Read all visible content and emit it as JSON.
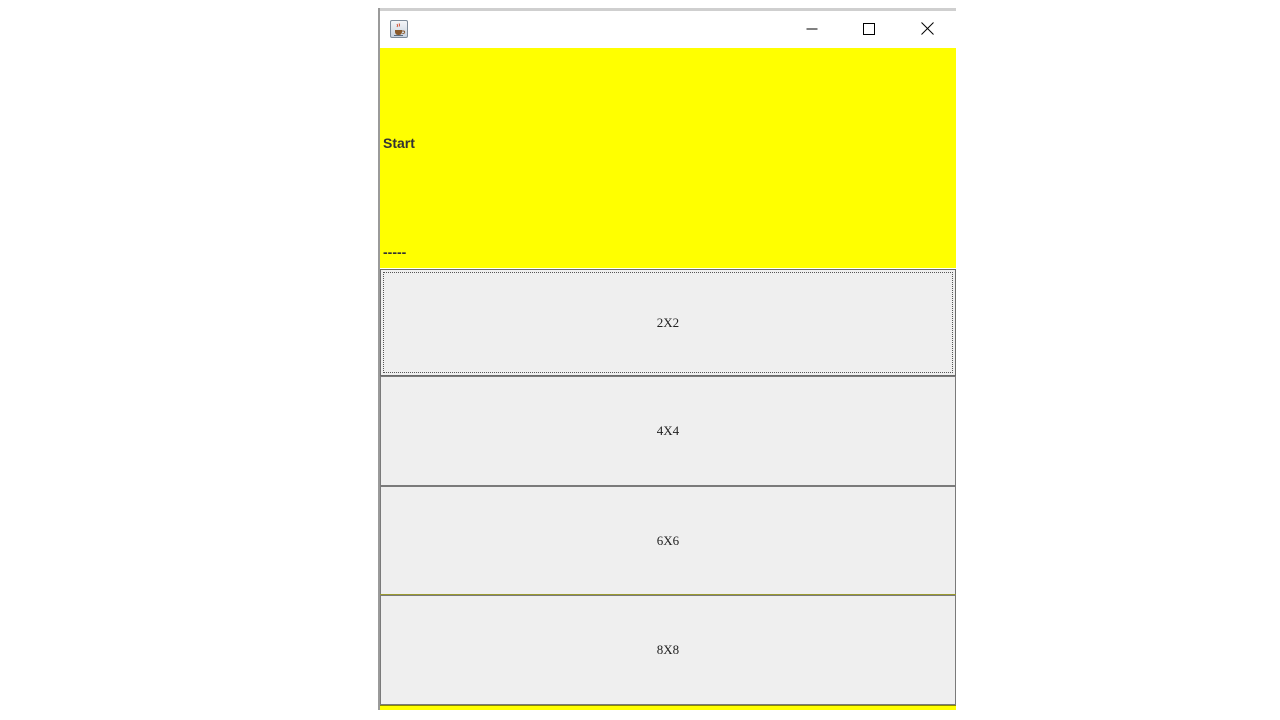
{
  "window": {
    "icon": "java-cup-icon",
    "controls": {
      "minimize_icon": "minimize-icon",
      "maximize_icon": "maximize-icon",
      "close_icon": "close-icon"
    }
  },
  "panel": {
    "background": "#ffff00",
    "start_label": "Start",
    "status_label": "-----"
  },
  "grid_buttons": [
    {
      "label": "2X2"
    },
    {
      "label": "4X4"
    },
    {
      "label": "6X6"
    },
    {
      "label": "8X8"
    }
  ]
}
